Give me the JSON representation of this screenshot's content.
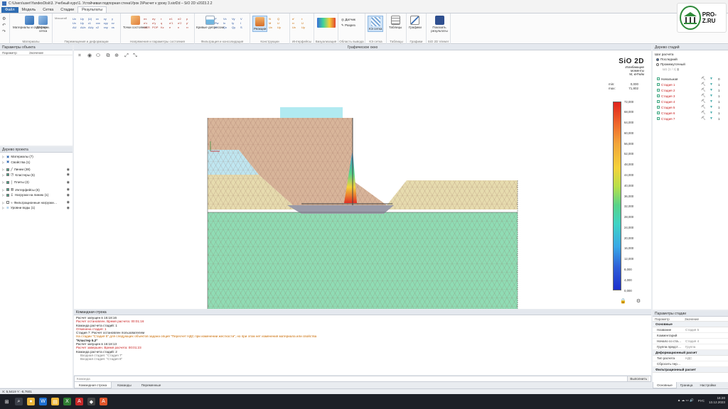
{
  "window": {
    "title": "C:\\Users\\user\\YandexDisk\\3. Учебный курс\\1. Устойчивая подпорная стена\\Урок 3\\Расчет к уроку 3.siof2d – SiO 2D v2023.2.2"
  },
  "menu": {
    "tabs": [
      {
        "label": "Файл"
      },
      {
        "label": "Модель"
      },
      {
        "label": "Сетка"
      },
      {
        "label": "Стадии"
      },
      {
        "label": "Результаты"
      }
    ]
  },
  "ribbon": {
    "groups": [
      {
        "caption": "Материалы",
        "buttons": [
          {
            "label": "Материалы и свойства"
          },
          {
            "label": "Деформ. сетка"
          }
        ]
      },
      {
        "caption": "Перемещения и деформации",
        "buttons": [
          {
            "label": "Масштаб"
          },
          {
            "label": "Ux"
          },
          {
            "label": "Uy"
          }
        ]
      },
      {
        "caption": "Напряжения и параметры состояния",
        "buttons": [
          {
            "label": "Точки состояния"
          }
        ]
      },
      {
        "caption": "Фильтрация и консолидация",
        "buttons": [
          {
            "label": "Кривые депрессии"
          }
        ]
      },
      {
        "caption": "Конструкции",
        "buttons": [
          {
            "label": "Реакции"
          }
        ]
      },
      {
        "caption": "Интерфейсы",
        "buttons": []
      },
      {
        "caption": "Визуализация",
        "buttons": []
      },
      {
        "caption": "Область вывода",
        "buttons": [
          {
            "label": "Датчик"
          },
          {
            "label": "Разрез"
          }
        ]
      },
      {
        "caption": "КЭ сетка",
        "buttons": [
          {
            "label": "КЭ сетка"
          }
        ]
      },
      {
        "caption": "Таблицы",
        "buttons": [
          {
            "label": "Таблицы"
          }
        ]
      },
      {
        "caption": "Графики",
        "buttons": [
          {
            "label": "Графики"
          }
        ]
      },
      {
        "caption": "SiO 2D Viewer",
        "buttons": [
          {
            "label": "Показать результаты"
          }
        ]
      }
    ]
  },
  "logo": {
    "text": "PRO-Z.RU"
  },
  "object_params": {
    "title": "Параметры объекта",
    "col_param": "Параметр",
    "col_value": "Значение"
  },
  "project_tree": {
    "title": "Дерево проекта",
    "items": [
      {
        "label": "Материалы (7)"
      },
      {
        "label": "Свойства (1)"
      },
      {
        "label": "Линии (38)"
      },
      {
        "label": "Кластеры (5)"
      },
      {
        "label": "Плиты (3)"
      },
      {
        "label": "Интерфейсы (6)"
      },
      {
        "label": "Нагрузки на линию (1)"
      },
      {
        "label": "Фильтрационные нагрузки…"
      },
      {
        "label": "Уровни воды (1)"
      }
    ]
  },
  "graphic": {
    "title": "Графическое окно",
    "legend": {
      "brand": "SiO 2D",
      "quantity": "Изгибающие",
      "quantity2": "моменты",
      "unit": "M, кН*м/м",
      "min_label": "min:",
      "min_value": "0,000",
      "max_label": "max:",
      "max_value": "71,802",
      "ticks": [
        "72,000",
        "68,000",
        "64,000",
        "60,000",
        "56,000",
        "52,000",
        "48,000",
        "44,000",
        "40,000",
        "36,000",
        "32,000",
        "28,000",
        "24,000",
        "20,000",
        "16,000",
        "12,000",
        "8,000",
        "4,000",
        "0,000"
      ]
    }
  },
  "command": {
    "title": "Командная строка",
    "lines": [
      {
        "text": "Расчет запущен в 16:18:16",
        "style": "dark"
      },
      {
        "text": "Расчет остановлен. Время расчета: 00:01:16",
        "style": "red"
      },
      {
        "text": "Команда расчета стадий: 1",
        "style": "dark"
      },
      {
        "text": "Отменена стадия: 1",
        "style": "red"
      },
      {
        "text": "Стадия 7: Расчет остановлен пользователем",
        "style": "dark"
      },
      {
        "text": "На стадии \"Стадия 5\" для следующих объектов задана опция \"Пересчет НДС при изменении жесткости\", но при этом нет изменения материала или свойства",
        "style": "orange"
      },
      {
        "text": "\"Кластер 5.2\"",
        "style": "bold"
      },
      {
        "text": "Расчет запущен в 16:18:13",
        "style": "dark"
      },
      {
        "text": "Расчет завершен. Время расчета: 00:01:23",
        "style": "red"
      },
      {
        "text": "Команда расчета стадий: 2",
        "style": "dark"
      },
      {
        "text": "Входная стадия: \"Стадия 7\"",
        "style": "gray"
      },
      {
        "text": "Входная стадия: \"Стадия 8\"",
        "style": "gray"
      }
    ],
    "input_placeholder": "Команда",
    "exec_label": "Выполнить",
    "tabs": [
      {
        "label": "Командная строка"
      },
      {
        "label": "Команды"
      },
      {
        "label": "Переменные"
      }
    ]
  },
  "stage_tree": {
    "title": "Дерево стадий",
    "step_label": "Шаг расчета",
    "opt_last": "Последний",
    "opt_intermediate": "Промежуточный",
    "step_value": "Ш1 (1 / 1)",
    "stages": [
      {
        "label": "Начальная",
        "n": "0",
        "color": "#222222"
      },
      {
        "label": "Стадия 1",
        "n": "1",
        "color": "#c81c1c"
      },
      {
        "label": "Стадия 2",
        "n": "1",
        "color": "#c81c1c"
      },
      {
        "label": "Стадия 3",
        "n": "1",
        "color": "#c81c1c"
      },
      {
        "label": "Стадия 4",
        "n": "1",
        "color": "#c81c1c"
      },
      {
        "label": "Стадия 5",
        "n": "1",
        "color": "#c81c1c"
      },
      {
        "label": "Стадия 6",
        "n": "1",
        "color": "#c81c1c"
      },
      {
        "label": "Стадия 7",
        "n": "1",
        "color": "#c81c1c"
      }
    ]
  },
  "stage_params": {
    "title": "Параметры стадии",
    "col_param": "Параметр",
    "col_value": "Значение",
    "sec_main": "Основные",
    "rows_main": [
      {
        "k": "Название",
        "v": "Стадия 5"
      },
      {
        "k": "Комментарий",
        "v": ""
      },
      {
        "k": "Начало со ста…",
        "v": "Стадия 4"
      },
      {
        "k": "Группа предст…",
        "v": "Группа"
      }
    ],
    "sec_def": "Деформационный расчет",
    "rows_def": [
      {
        "k": "Тип расчета",
        "v": "НДС"
      },
      {
        "k": "Сбросить пер…",
        "v": ""
      }
    ],
    "sec_filt": "Фильтрационный расчет",
    "tabs": [
      {
        "label": "Основные"
      },
      {
        "label": "Граница"
      },
      {
        "label": "Настройки"
      }
    ]
  },
  "status": {
    "coords": "X: 5,5419 Y: -8,7601"
  },
  "taskbar": {
    "lang": "РУС",
    "time": "16:20",
    "date": "13.12.2023"
  },
  "colors": {
    "soil_top": "#d8b59a",
    "soil_mid": "#e6dbae",
    "soil_low": "#8fdcb4",
    "water": "#bfe6f0"
  }
}
